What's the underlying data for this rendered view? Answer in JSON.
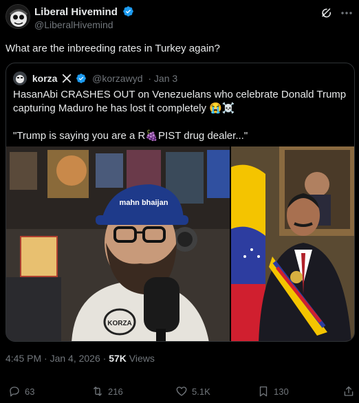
{
  "author": {
    "display_name": "Liberal Hivemind",
    "handle": "@LiberalHivemind"
  },
  "post_text": "What are the inbreeding rates in Turkey again?",
  "quoted": {
    "display_name": "korza",
    "handle": "@korzawyd",
    "date": "· Jan 3",
    "line1": "HasanAbi CRASHES OUT on Venezuelans who celebrate Donald Trump capturing Maduro he has lost it completely 😭☠️",
    "line2": "\"Trump is saying you are a R🍇PIST drug dealer...\"",
    "media_left_text": "mahn bhaijan",
    "media_left_shirt_text": "KORZA"
  },
  "meta": {
    "time": "4:45 PM · Jan 4, 2026 · ",
    "views_count": "57K",
    "views_label": " Views"
  },
  "actions": {
    "replies": "63",
    "reposts": "216",
    "likes": "5.1K",
    "bookmarks": "130"
  },
  "colors": {
    "background": "#000000",
    "text": "#e7e9ea",
    "muted": "#71767b",
    "verified": "#1d9bf0",
    "border": "#2f3336"
  }
}
